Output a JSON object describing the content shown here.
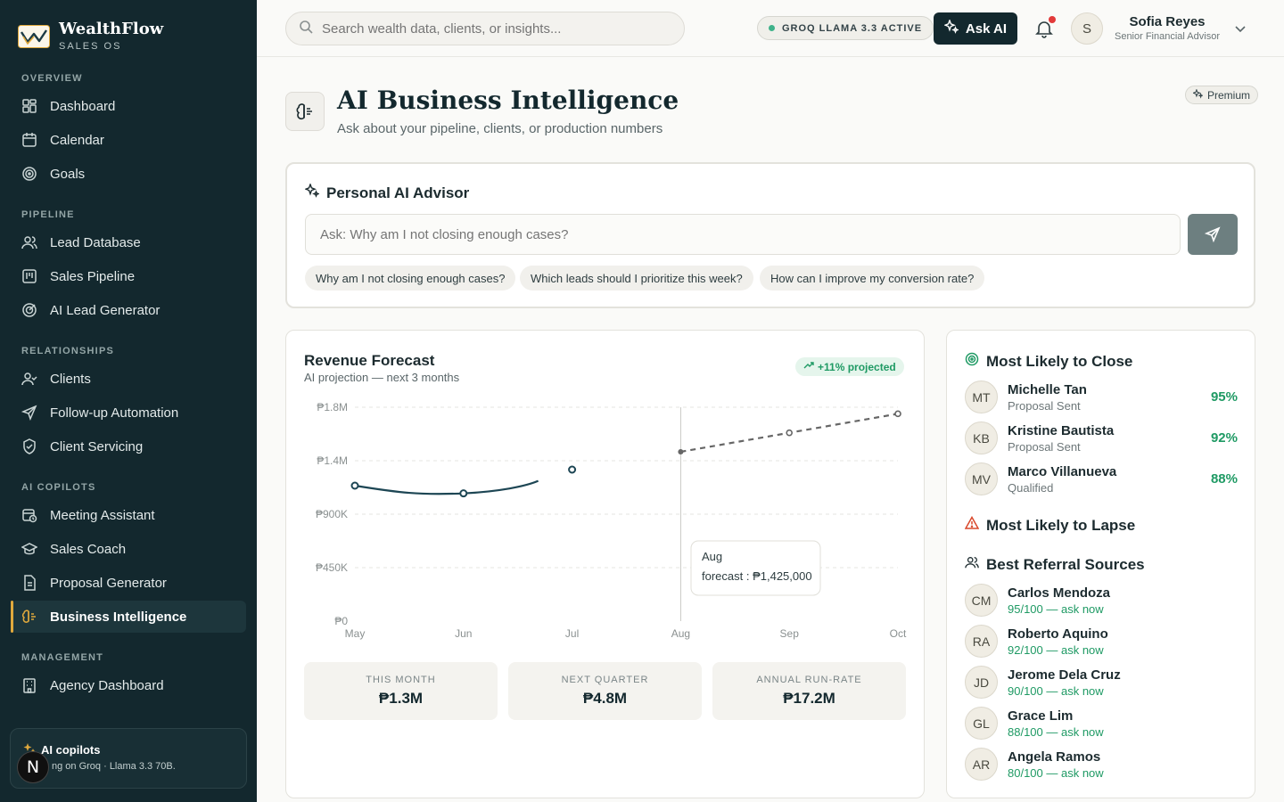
{
  "brand": {
    "name": "WealthFlow",
    "sub": "SALES OS"
  },
  "sidebar": {
    "sections": [
      {
        "label": "OVERVIEW",
        "items": [
          {
            "label": "Dashboard",
            "icon": "grid-icon"
          },
          {
            "label": "Calendar",
            "icon": "calendar-icon"
          },
          {
            "label": "Goals",
            "icon": "target-icon"
          }
        ]
      },
      {
        "label": "PIPELINE",
        "items": [
          {
            "label": "Lead Database",
            "icon": "users-icon"
          },
          {
            "label": "Sales Pipeline",
            "icon": "kanban-icon"
          },
          {
            "label": "AI Lead Generator",
            "icon": "radar-icon"
          }
        ]
      },
      {
        "label": "RELATIONSHIPS",
        "items": [
          {
            "label": "Clients",
            "icon": "user-check-icon"
          },
          {
            "label": "Follow-up Automation",
            "icon": "send-icon"
          },
          {
            "label": "Client Servicing",
            "icon": "shield-icon"
          }
        ]
      },
      {
        "label": "AI COPILOTS",
        "items": [
          {
            "label": "Meeting Assistant",
            "icon": "calendar-clock-icon"
          },
          {
            "label": "Sales Coach",
            "icon": "graduation-cap-icon"
          },
          {
            "label": "Proposal Generator",
            "icon": "file-text-icon"
          },
          {
            "label": "Business Intelligence",
            "icon": "brain-icon"
          }
        ]
      },
      {
        "label": "MANAGEMENT",
        "items": [
          {
            "label": "Agency Dashboard",
            "icon": "building-icon"
          }
        ]
      }
    ],
    "active": "Business Intelligence",
    "copilot": {
      "title": "AI copilots",
      "sub": "ng on Groq · Llama 3.3 70B."
    },
    "n_badge": "N"
  },
  "header": {
    "search_placeholder": "Search wealth data, clients, or insights...",
    "status_pill": "GROQ LLAMA 3.3 ACTIVE",
    "ask_ai": "Ask AI",
    "user": {
      "initial": "S",
      "name": "Sofia Reyes",
      "role": "Senior Financial Advisor"
    }
  },
  "page": {
    "title": "AI Business Intelligence",
    "subtitle": "Ask about your pipeline, clients, or production numbers",
    "badge": "Premium"
  },
  "advisor": {
    "title": "Personal AI Advisor",
    "placeholder": "Ask: Why am I not closing enough cases?",
    "chips": [
      "Why am I not closing enough cases?",
      "Which leads should I prioritize this week?",
      "How can I improve my conversion rate?"
    ]
  },
  "forecast": {
    "title": "Revenue Forecast",
    "subtitle": "AI projection — next 3 months",
    "pill": "+11% projected",
    "tooltip": {
      "title": "Aug",
      "text": "forecast : ₱1,425,000"
    },
    "stats": [
      {
        "label": "THIS MONTH",
        "value": "₱1.3M"
      },
      {
        "label": "NEXT QUARTER",
        "value": "₱4.8M"
      },
      {
        "label": "ANNUAL RUN-RATE",
        "value": "₱17.2M"
      }
    ]
  },
  "chart_data": {
    "type": "line",
    "x": [
      "May",
      "Jun",
      "Jul",
      "Aug",
      "Sep",
      "Oct"
    ],
    "yticks": [
      0,
      450000,
      900000,
      1350000,
      1800000
    ],
    "ytick_labels": [
      "₱0",
      "₱450K",
      "₱900K",
      "₱1.4M",
      "₱1.8M"
    ],
    "ylim": [
      0,
      1800000
    ],
    "series": [
      {
        "style": "solid",
        "points": [
          [
            "May",
            1140000
          ],
          [
            "Jun",
            1075000
          ],
          [
            "Jul",
            1275000
          ]
        ]
      },
      {
        "style": "dashed",
        "points": [
          [
            "Aug",
            1425000
          ],
          [
            "Sep",
            1585000
          ],
          [
            "Oct",
            1745000
          ]
        ]
      }
    ],
    "cursor_x": "Aug",
    "grid": true
  },
  "close": {
    "title": "Most Likely to Close",
    "people": [
      {
        "initials": "MT",
        "name": "Michelle Tan",
        "stage": "Proposal Sent",
        "pct": "95%"
      },
      {
        "initials": "KB",
        "name": "Kristine Bautista",
        "stage": "Proposal Sent",
        "pct": "92%"
      },
      {
        "initials": "MV",
        "name": "Marco Villanueva",
        "stage": "Qualified",
        "pct": "88%"
      }
    ]
  },
  "lapse": {
    "title": "Most Likely to Lapse"
  },
  "referral": {
    "title": "Best Referral Sources",
    "people": [
      {
        "initials": "CM",
        "name": "Carlos Mendoza",
        "score": "95/100 — ask now"
      },
      {
        "initials": "RA",
        "name": "Roberto Aquino",
        "score": "92/100 — ask now"
      },
      {
        "initials": "JD",
        "name": "Jerome Dela Cruz",
        "score": "90/100 — ask now"
      },
      {
        "initials": "GL",
        "name": "Grace Lim",
        "score": "88/100 — ask now"
      },
      {
        "initials": "AR",
        "name": "Angela Ramos",
        "score": "80/100 — ask now"
      }
    ]
  },
  "colors": {
    "sidebar_bg": "#13282e",
    "accent": "#e0a93d",
    "positive": "#1f9a64",
    "warning": "#d9482b",
    "line": "#1d4654"
  }
}
